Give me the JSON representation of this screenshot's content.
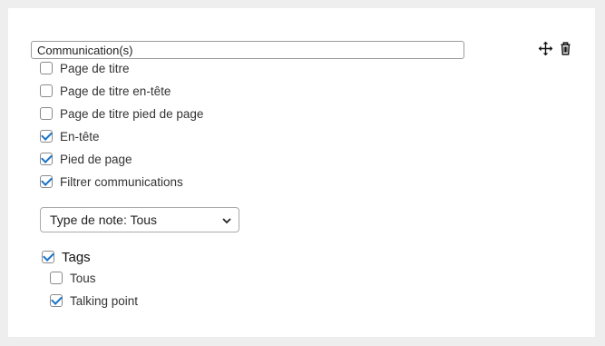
{
  "section": {
    "title_value": "Communication(s)",
    "icons": {
      "move": "move-arrows-icon",
      "delete": "trash-icon"
    }
  },
  "options": [
    {
      "label": "Page de titre",
      "checked": false
    },
    {
      "label": "Page de titre en-tête",
      "checked": false
    },
    {
      "label": "Page de titre pied de page",
      "checked": false
    },
    {
      "label": "En-tête",
      "checked": true
    },
    {
      "label": "Pied de page",
      "checked": true
    },
    {
      "label": "Filtrer communications",
      "checked": true
    }
  ],
  "note_type": {
    "selected": "Type de note: Tous"
  },
  "tags": {
    "label": "Tags",
    "checked": true,
    "items": [
      {
        "label": "Tous",
        "checked": false
      },
      {
        "label": "Talking point",
        "checked": true
      }
    ]
  },
  "colors": {
    "accent": "#1a73c8",
    "background": "#eeeeee",
    "panel": "#ffffff"
  }
}
